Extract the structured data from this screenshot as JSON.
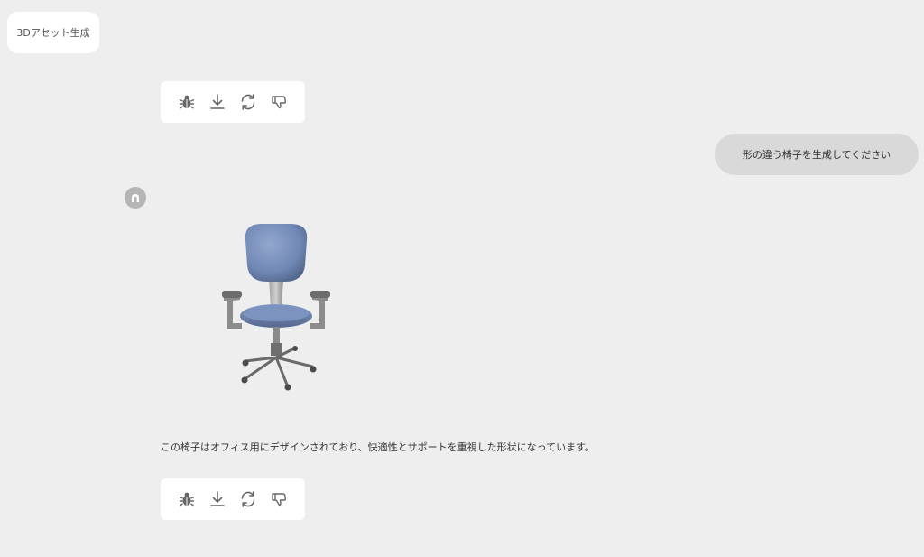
{
  "header": {
    "tag_label": "3Dアセット生成"
  },
  "toolbar": {
    "icons": [
      "bug-icon",
      "download-icon",
      "regenerate-icon",
      "thumbs-down-icon"
    ]
  },
  "conversation": {
    "user_message": "形の違う椅子を生成してください",
    "assistant_reply": "この椅子はオフィス用にデザインされており、快適性とサポートを重視した形状になっています。",
    "model_asset": "office-chair-3d-model"
  },
  "colors": {
    "background": "#eeeeee",
    "card": "#ffffff",
    "user_bubble": "#d9d9d9",
    "avatar": "#b5b5b5",
    "icon": "#666666",
    "chair_seat": "#7189b5"
  }
}
